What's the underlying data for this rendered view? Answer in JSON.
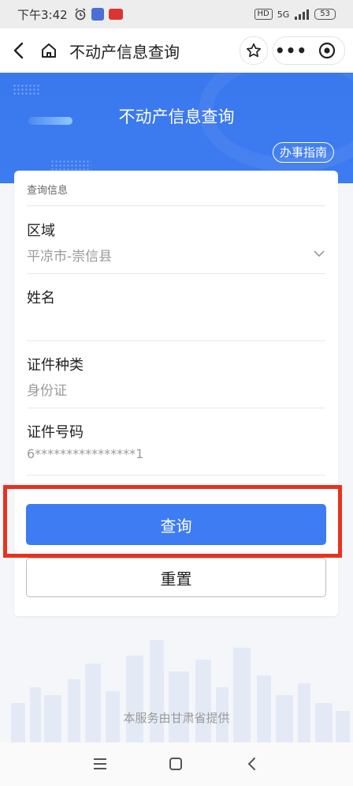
{
  "status_bar": {
    "time": "下午3:42",
    "signal": "5G",
    "hd": "HD",
    "battery": "53"
  },
  "nav": {
    "title": "不动产信息查询"
  },
  "banner": {
    "title": "不动产信息查询",
    "guide_label": "办事指南"
  },
  "form": {
    "section_title": "查询信息",
    "fields": [
      {
        "label": "区域",
        "value": "平凉市-崇信县"
      },
      {
        "label": "姓名",
        "value": ""
      },
      {
        "label": "证件种类",
        "value": "身份证"
      },
      {
        "label": "证件号码",
        "value": "6****************1"
      }
    ],
    "query_label": "查询",
    "reset_label": "重置"
  },
  "footer": {
    "text": "本服务由甘肃省提供"
  },
  "colors": {
    "accent": "#3e7cf3",
    "banner": "#3a78ee",
    "highlight": "#e8321e"
  },
  "icons": [
    "back-icon",
    "home-icon",
    "star-icon",
    "more-icon",
    "target-icon",
    "chevron-down-icon",
    "menu-icon",
    "square-icon",
    "back-nav-icon"
  ]
}
